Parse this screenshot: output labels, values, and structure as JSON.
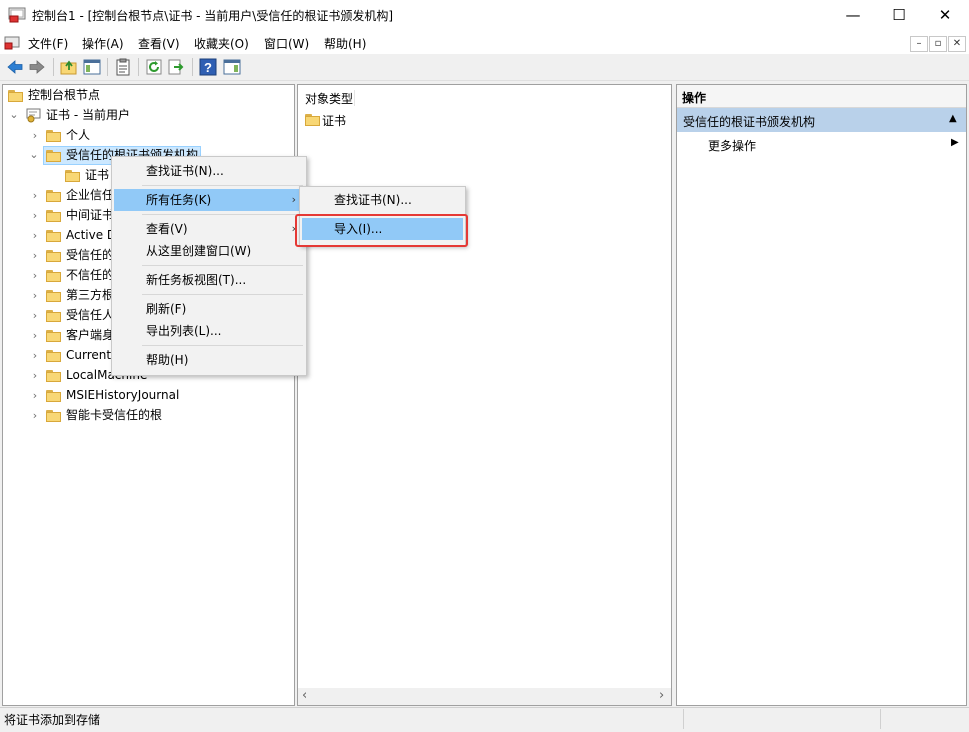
{
  "window": {
    "title": "控制台1 - [控制台根节点\\证书 - 当前用户\\受信任的根证书颁发机构]",
    "minimize": "—",
    "maximize": "☐",
    "close": "✕"
  },
  "menubar": {
    "items": [
      "文件(F)",
      "操作(A)",
      "查看(V)",
      "收藏夹(O)",
      "窗口(W)",
      "帮助(H)"
    ],
    "mdi": [
      "–",
      "▫",
      "✕"
    ]
  },
  "toolbar": {
    "icons": [
      "back-arrow-icon",
      "forward-arrow-icon",
      "up-folder-icon",
      "show-hide-tree-icon",
      "properties-icon",
      "refresh-icon",
      "export-list-icon",
      "help-icon",
      "show-action-pane-icon"
    ]
  },
  "tree": {
    "root": "控制台根节点",
    "store": "证书 - 当前用户",
    "items": [
      "个人",
      "受信任的根证书颁发机构",
      "证书",
      "企业信任",
      "中间证书颁发机构",
      "Active Directory 用户对象",
      "受信任的发布者",
      "不信任的证书",
      "第三方根证书颁发机构",
      "受信任人",
      "客户端身份验证颁发者",
      "CurrentUser",
      "LocalMachine",
      "MSIEHistoryJournal",
      "智能卡受信任的根"
    ],
    "visible_labels": [
      "个人",
      "受信任的根证书颁发机构",
      "证书",
      "企业信任",
      "中间证书",
      "Active D",
      "受信任的",
      "不信任的",
      "第三方根",
      "受信任人",
      "客户端身",
      "CurrentU",
      "LocalMachine",
      "MSIEHistoryJournal",
      "智能卡受信任的根"
    ]
  },
  "list": {
    "column_header": "对象类型",
    "items": [
      "证书"
    ]
  },
  "actions": {
    "header": "操作",
    "section": "受信任的根证书颁发机构",
    "more": "更多操作"
  },
  "context_menu": {
    "items": [
      "查找证书(N)...",
      "所有任务(K)",
      "查看(V)",
      "从这里创建窗口(W)",
      "新任务板视图(T)...",
      "刷新(F)",
      "导出列表(L)...",
      "帮助(H)"
    ]
  },
  "submenu": {
    "items": [
      "查找证书(N)...",
      "导入(I)..."
    ]
  },
  "status": {
    "text": "将证书添加到存储"
  },
  "colors": {
    "highlight": "#91c9f7",
    "action_section": "#b9d1ea",
    "red_frame": "#e53935"
  }
}
